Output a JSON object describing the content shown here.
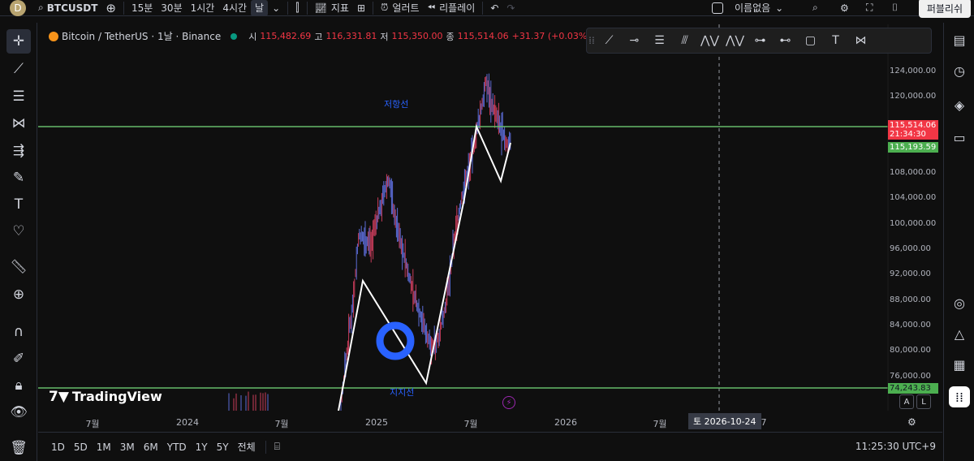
{
  "topbar": {
    "avatar_letter": "D",
    "symbol": "BTCUSDT",
    "timeframes": [
      "15분",
      "30분",
      "1시간",
      "4시간",
      "날"
    ],
    "indicators_label": "지표",
    "alert_label": "얼러트",
    "replay_label": "리플레이",
    "layout_name": "이름없음",
    "publish_label": "퍼블리쉬"
  },
  "legend": {
    "title": "Bitcoin / TetherUS · 1날 · Binance",
    "open_label": "시",
    "open": "115,482.69",
    "high_label": "고",
    "high": "116,331.81",
    "low_label": "저",
    "low": "115,350.00",
    "close_label": "종",
    "close": "115,514.06",
    "change": "+31.37 (+0.03%)"
  },
  "price_axis": {
    "labels": [
      "124,000.00",
      "120,000.00",
      "108,000.00",
      "104,000.00",
      "100,000.00",
      "96,000.00",
      "92,000.00",
      "88,000.00",
      "84,000.00",
      "80,000.00",
      "76,000.00"
    ],
    "current_price": "115,514.06",
    "countdown": "21:34:30",
    "level_upper": "115,193.59",
    "level_lower": "74,243.83"
  },
  "time_axis": {
    "labels": [
      "7월",
      "2024",
      "7월",
      "2025",
      "7월",
      "2026",
      "7월",
      "027"
    ],
    "cursor_date": "토 2026-10-24"
  },
  "annotations": {
    "resistance": "저항선",
    "support": "지지선"
  },
  "branding": "TradingView",
  "bottombar": {
    "ranges": [
      "1D",
      "5D",
      "1M",
      "3M",
      "6M",
      "YTD",
      "1Y",
      "5Y",
      "전체"
    ],
    "clock": "11:25:30 UTC+9"
  },
  "scale_buttons": {
    "a": "A",
    "l": "L"
  },
  "colors": {
    "background": "#0f0f0f",
    "up": "#5b6bd6",
    "down": "#c83c5a",
    "level_line": "#66bb6a",
    "price_tag": "#f23645",
    "annotation": "#2962ff"
  },
  "icons": {
    "left_tools": [
      "crosshair-icon",
      "trend-line-icon",
      "fib-icon",
      "pattern-icon",
      "projection-icon",
      "brush-icon",
      "text-icon",
      "heart-icon",
      "ruler-icon",
      "zoom-icon",
      "magnet-icon",
      "lock-draw-icon",
      "lock-icon",
      "eye-icon",
      "trash-icon"
    ],
    "right_tools": [
      "watchlist-icon",
      "alarm-icon",
      "layers-icon",
      "chat-icon",
      "target-icon",
      "ideas-icon",
      "calendar-icon",
      "apps-icon"
    ]
  },
  "chart_data": {
    "type": "candlestick",
    "ylim": [
      72000,
      126000
    ],
    "price_levels": [
      115193.59,
      74243.83
    ]
  }
}
